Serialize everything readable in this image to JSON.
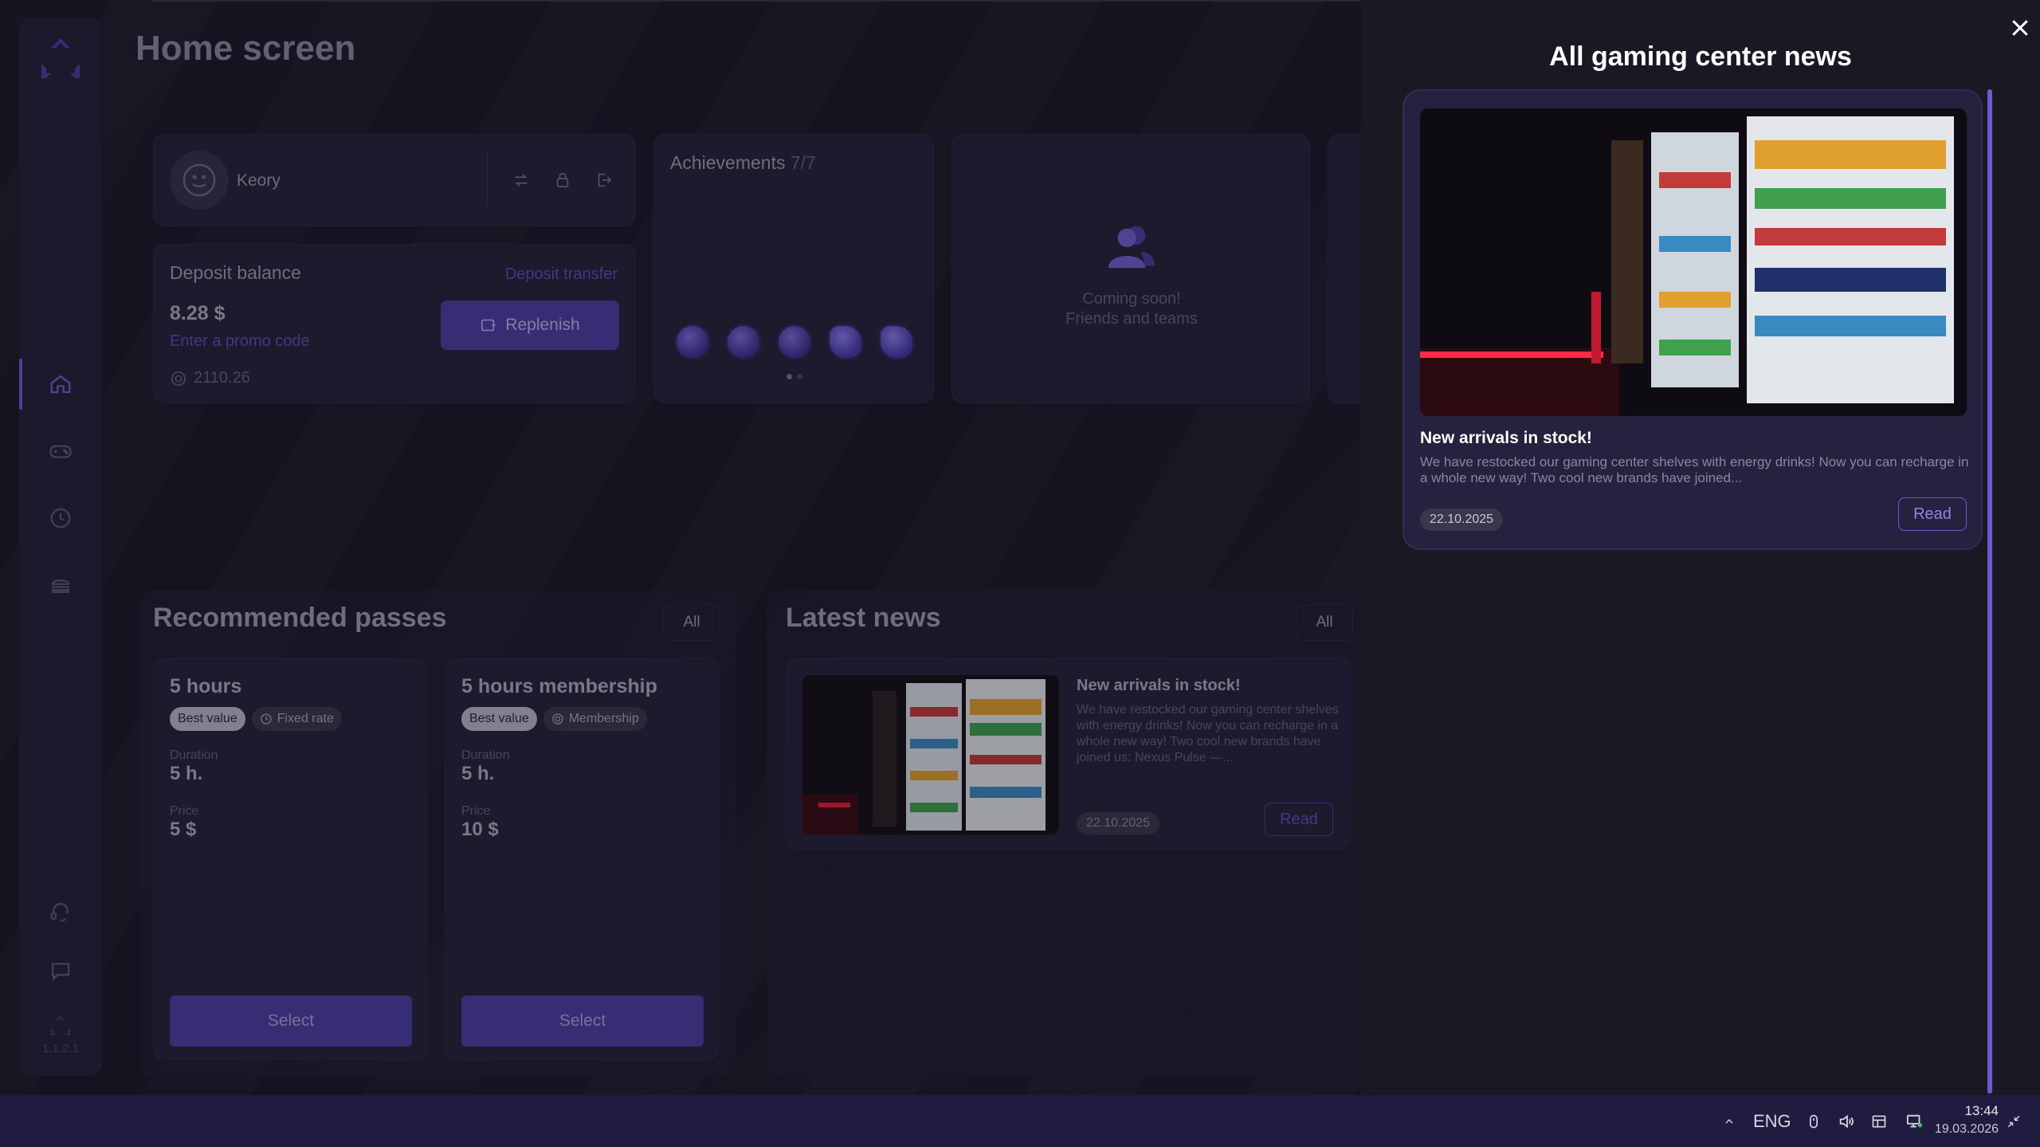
{
  "app": {
    "version": "1.1.2.1"
  },
  "page": {
    "title": "Home screen"
  },
  "user": {
    "name": "Keory"
  },
  "deposit": {
    "title": "Deposit balance",
    "transfer_label": "Deposit transfer",
    "amount": "8.28 $",
    "promo_label": "Enter a promo code",
    "points": "2110.26",
    "replenish_label": "Replenish"
  },
  "achievements": {
    "title": "Achievements",
    "count": "7/7"
  },
  "friends": {
    "line1": "Coming soon!",
    "line2": "Friends and teams"
  },
  "passes": {
    "title": "Recommended passes",
    "all_label": "All",
    "items": [
      {
        "name": "5 hours",
        "tag1": "Best value",
        "tag2": "Fixed rate",
        "duration_label": "Duration",
        "duration": "5 h.",
        "price_label": "Price",
        "price": "5 $",
        "select_label": "Select"
      },
      {
        "name": "5 hours membership",
        "tag1": "Best value",
        "tag2": "Membership",
        "duration_label": "Duration",
        "duration": "5 h.",
        "price_label": "Price",
        "price": "10 $",
        "select_label": "Select"
      }
    ]
  },
  "news": {
    "title": "Latest news",
    "all_label": "All",
    "item": {
      "title": "New arrivals in stock!",
      "body": "We have restocked our gaming center shelves with energy drinks! Now you can recharge in a whole new way! Two cool new brands have joined us: Nexus Pulse —...",
      "date": "22.10.2025",
      "read_label": "Read"
    }
  },
  "drawer": {
    "title": "All gaming center news",
    "item": {
      "title": "New arrivals in stock!",
      "body": "We have restocked our gaming center shelves with energy drinks! Now you can recharge in a whole new way! Two cool new brands have joined...",
      "date": "22.10.2025",
      "read_label": "Read"
    }
  },
  "taskbar": {
    "language": "ENG",
    "time": "13:44",
    "date": "19.03.2026"
  },
  "colors": {
    "accent": "#4b3fa3",
    "accent_text": "#5b4fb5",
    "background": "#1a1826",
    "taskbar": "#201c3f"
  }
}
